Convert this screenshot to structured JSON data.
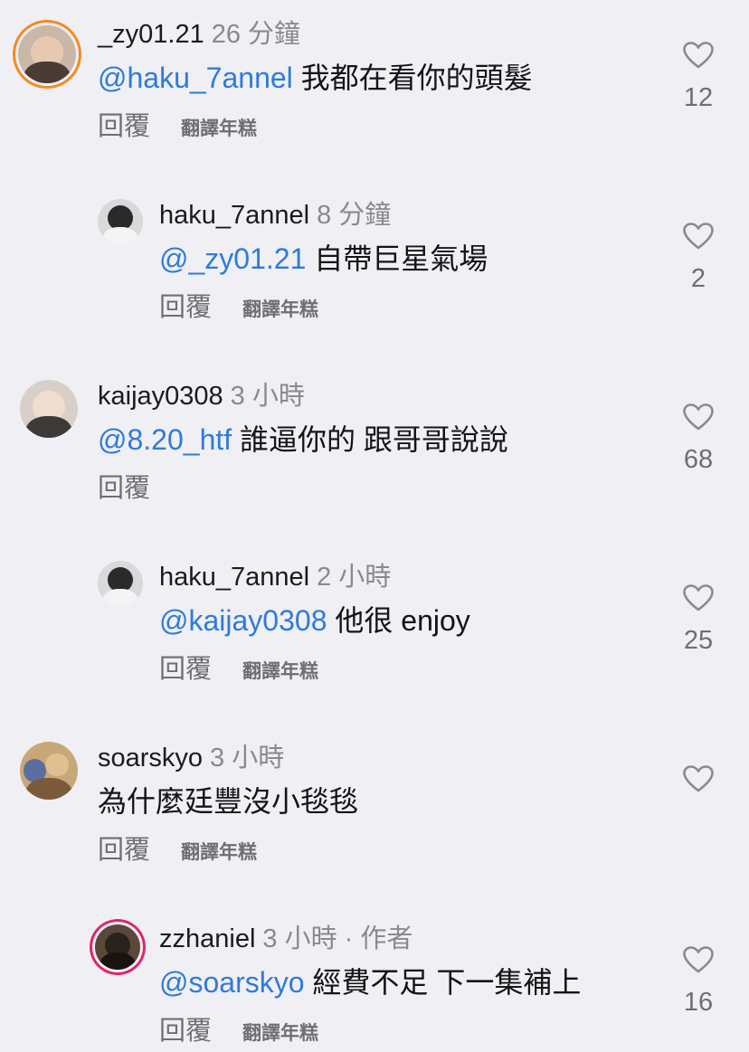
{
  "comments": [
    {
      "username": "_zy01.21",
      "time": "26 分鐘",
      "mention": "@haku_7annel",
      "text": " 我都在看你的頭髮",
      "reply_label": "回覆",
      "translate_label": "翻譯年糕",
      "like_count": "12"
    },
    {
      "username": "haku_7annel",
      "time": "8 分鐘",
      "mention": "@_zy01.21",
      "text": " 自帶巨星氣場",
      "reply_label": "回覆",
      "translate_label": "翻譯年糕",
      "like_count": "2"
    },
    {
      "username": "kaijay0308",
      "time": "3 小時",
      "mention": "@8.20_htf",
      "text": " 誰逼你的 跟哥哥說說",
      "reply_label": "回覆",
      "translate_label": "",
      "like_count": "68"
    },
    {
      "username": "haku_7annel",
      "time": "2 小時",
      "mention": "@kaijay0308",
      "text": " 他很 enjoy",
      "reply_label": "回覆",
      "translate_label": "翻譯年糕",
      "like_count": "25"
    },
    {
      "username": "soarskyo",
      "time": "3 小時",
      "mention": "",
      "text": "為什麼廷豐沒小毯毯",
      "reply_label": "回覆",
      "translate_label": "翻譯年糕",
      "like_count": ""
    },
    {
      "username": "zzhaniel",
      "time": "3 小時 · 作者",
      "mention": "@soarskyo",
      "text": " 經費不足 下一集補上",
      "reply_label": "回覆",
      "translate_label": "翻譯年糕",
      "like_count": "16"
    }
  ],
  "colors": {
    "background": "#efeff4",
    "mention": "#2f7bd8",
    "muted": "#8a8a8e",
    "story_ring": "#e0256b"
  },
  "icons": {
    "like": "heart-outline-icon"
  }
}
